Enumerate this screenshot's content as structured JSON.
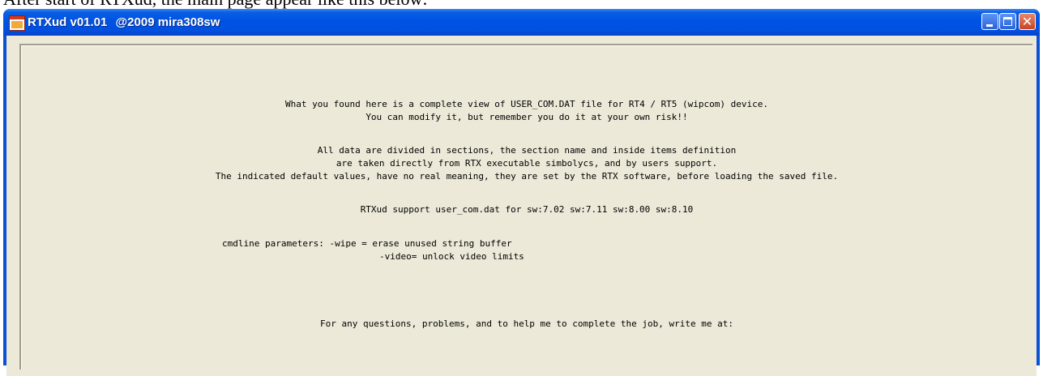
{
  "page_caption": "After start of RTXud, the main page appear like this below:",
  "window": {
    "title": "RTXud v01.01",
    "copyright": "@2009 mira308sw",
    "app_icon": "window-app-icon",
    "controls": {
      "minimize_icon": "minimize-icon",
      "maximize_icon": "maximize-icon",
      "close_icon": "close-icon",
      "close_glyph": "✕"
    },
    "colors": {
      "titlebar": "#0054e3",
      "client": "#ece9d8",
      "close_button": "#c74424"
    }
  },
  "intro": {
    "line1": "What you found here is a complete view of USER_COM.DAT file for RT4 / RT5 (wipcom) device.",
    "line2": "You can modify it, but remember you do it at your own risk!!",
    "line3": "All data are divided in sections, the section name and inside items definition",
    "line4": "are taken directly from RTX executable simbolycs, and by users support.",
    "line5": "The indicated default values, have no real meaning, they are set by the RTX software, before loading the saved file.",
    "line6": "RTXud support user_com.dat for sw:7.02 sw:7.11 sw:8.00 sw:8.10",
    "cmd1": "cmdline parameters: -wipe = erase unused string buffer",
    "cmd2": "-video= unlock video limits",
    "contact": "For any questions, problems, and to help me to complete the job, write me at:"
  }
}
